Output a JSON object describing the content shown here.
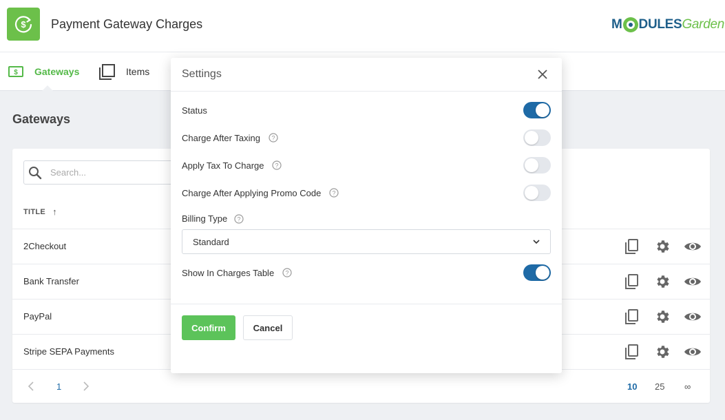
{
  "header": {
    "title": "Payment Gateway Charges",
    "brand": {
      "part1": "M",
      "part2": "DULES",
      "part3": "Garden"
    }
  },
  "tabs": [
    {
      "label": "Gateways",
      "icon": "dollar-bill-icon",
      "active": true
    },
    {
      "label": "Items",
      "icon": "copy-icon",
      "active": false
    }
  ],
  "page": {
    "heading": "Gateways",
    "search_placeholder": "Search...",
    "column_title": "TITLE",
    "sort_arrow": "↑"
  },
  "gateways": [
    {
      "name": "2Checkout"
    },
    {
      "name": "Bank Transfer"
    },
    {
      "name": "PayPal"
    },
    {
      "name": "Stripe SEPA Payments"
    }
  ],
  "pagination": {
    "prev": "<",
    "current": "1",
    "next": ">",
    "per_page": [
      "10",
      "25",
      "∞"
    ]
  },
  "modal": {
    "title": "Settings",
    "fields": [
      {
        "label": "Status",
        "on": true,
        "help": false
      },
      {
        "label": "Charge After Taxing",
        "on": false,
        "help": true
      },
      {
        "label": "Apply Tax To Charge",
        "on": false,
        "help": true
      },
      {
        "label": "Charge After Applying Promo Code",
        "on": false,
        "help": true
      }
    ],
    "billing_type_label": "Billing Type",
    "billing_type_value": "Standard",
    "show_in_table_label": "Show In Charges Table",
    "show_in_table_on": true,
    "confirm_label": "Confirm",
    "cancel_label": "Cancel"
  },
  "colors": {
    "accent_green": "#5cc35a",
    "toggle_blue": "#1e6aa6",
    "brand_blue": "#1e5f8a"
  }
}
